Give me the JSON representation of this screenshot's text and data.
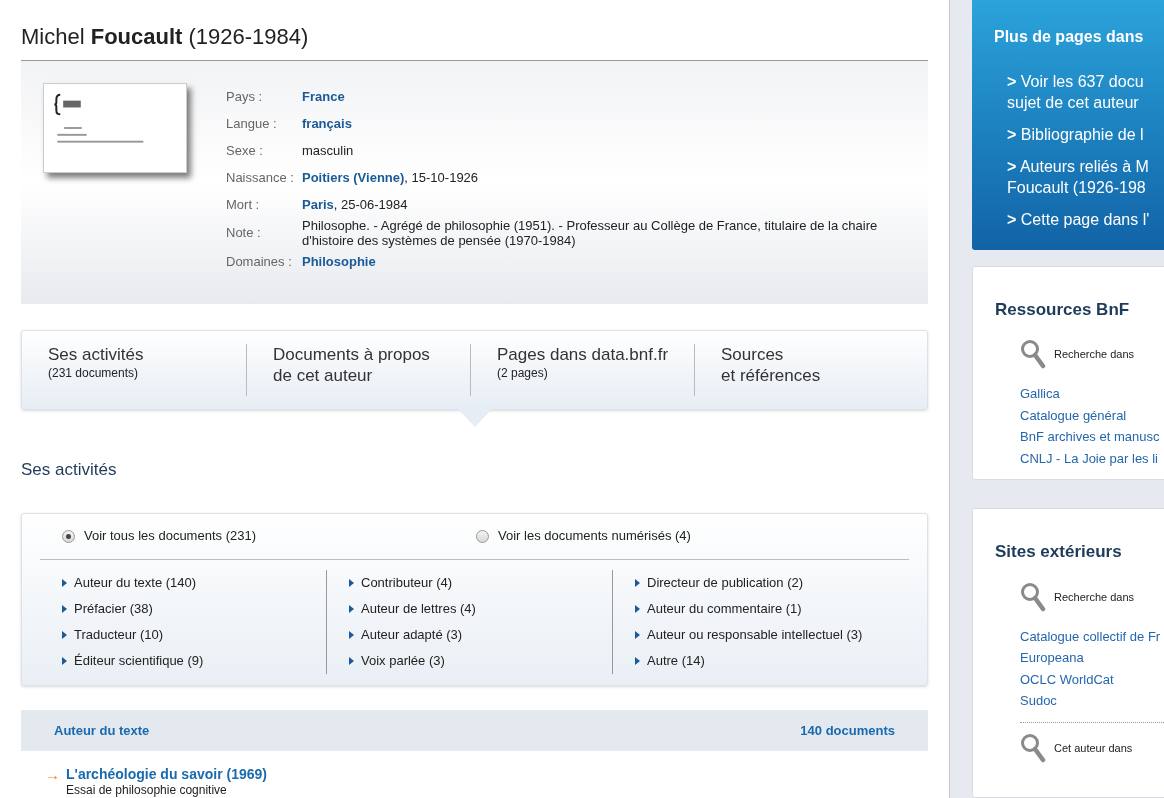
{
  "title": "Michel **Foucault** (1926-1984)",
  "notice": {
    "fields": [
      {
        "label": "Pays :",
        "parts": [
          {
            "text": "France",
            "link": true
          }
        ]
      },
      {
        "label": "Langue :",
        "parts": [
          {
            "text": "français",
            "link": true
          }
        ]
      },
      {
        "label": "Sexe :",
        "parts": [
          {
            "text": "masculin",
            "link": false
          }
        ]
      },
      {
        "label": "Naissance :",
        "parts": [
          {
            "text": "Poitiers (Vienne)",
            "link": true
          },
          {
            "text": ", 15-10-1926",
            "link": false
          }
        ]
      },
      {
        "label": "Mort :",
        "parts": [
          {
            "text": "Paris",
            "link": true
          },
          {
            "text": ", 25-06-1984",
            "link": false
          }
        ]
      },
      {
        "label": "Note :",
        "parts": [
          {
            "text": "Philosophe. - Agrégé de philosophie (1951). - Professeur au Collège de France, titulaire de la chaire d'histoire des systèmes de pensée (1970-1984)",
            "link": false
          }
        ]
      },
      {
        "label": "Domaines :",
        "parts": [
          {
            "text": "Philosophie",
            "link": true
          }
        ]
      }
    ]
  },
  "tabs": [
    {
      "title": "Ses activités",
      "sub": "(231 documents)"
    },
    {
      "title": "Documents à propos",
      "sub": "de cet auteur",
      "kind": "two-line"
    },
    {
      "title": "Pages dans data.bnf.fr",
      "sub": "(2 pages)"
    },
    {
      "title": "Sources",
      "sub": "et références",
      "kind": "two-line"
    }
  ],
  "section_title": "Ses activités",
  "filters": {
    "radios": [
      {
        "label": "Voir tous les documents (231)",
        "selected": true
      },
      {
        "label": "Voir les documents numérisés (4)",
        "selected": false
      }
    ],
    "columns": [
      [
        "Auteur du texte (140)",
        "Préfacier (38)",
        "Traducteur (10)",
        "Éditeur scientifique (9)"
      ],
      [
        "Contributeur (4)",
        "Auteur de lettres (4)",
        "Auteur adapté (3)",
        "Voix parlée (3)"
      ],
      [
        "Directeur de publication (2)",
        "Auteur du commentaire (1)",
        "Auteur ou responsable intellectuel (3)",
        "Autre (14)"
      ]
    ]
  },
  "results": {
    "heading": "Auteur du texte",
    "count": "140 documents",
    "items": [
      {
        "arrow": "→",
        "title": "L'archéologie du savoir (1969)",
        "subtitle": "Essai de philosophie cognitive"
      }
    ]
  },
  "sidebar": {
    "more": {
      "title": "Plus de pages dans",
      "links": [
        {
          "lines": [
            "**>** Voir les 637 docu",
            "sujet de cet auteur"
          ]
        },
        {
          "lines": [
            "**>** Bibliographie de l"
          ]
        },
        {
          "lines": [
            "**>** Auteurs reliés à M",
            "Foucault (1926-198"
          ]
        },
        {
          "lines": [
            "**>** Cette page dans l'"
          ]
        }
      ]
    },
    "cards": [
      {
        "title": "Ressources BnF",
        "groups": [
          {
            "label": "Recherche dans",
            "links": [
              "Gallica",
              "Catalogue général",
              "BnF archives et manusc",
              "CNLJ - La Joie par les li"
            ]
          }
        ]
      },
      {
        "title": "Sites extérieurs",
        "groups": [
          {
            "label": "Recherche dans",
            "links": [
              "Catalogue collectif de Fr",
              "Europeana",
              "OCLC WorldCat",
              "Sudoc"
            ]
          },
          {
            "label": "Cet auteur dans"
          }
        ]
      }
    ]
  }
}
